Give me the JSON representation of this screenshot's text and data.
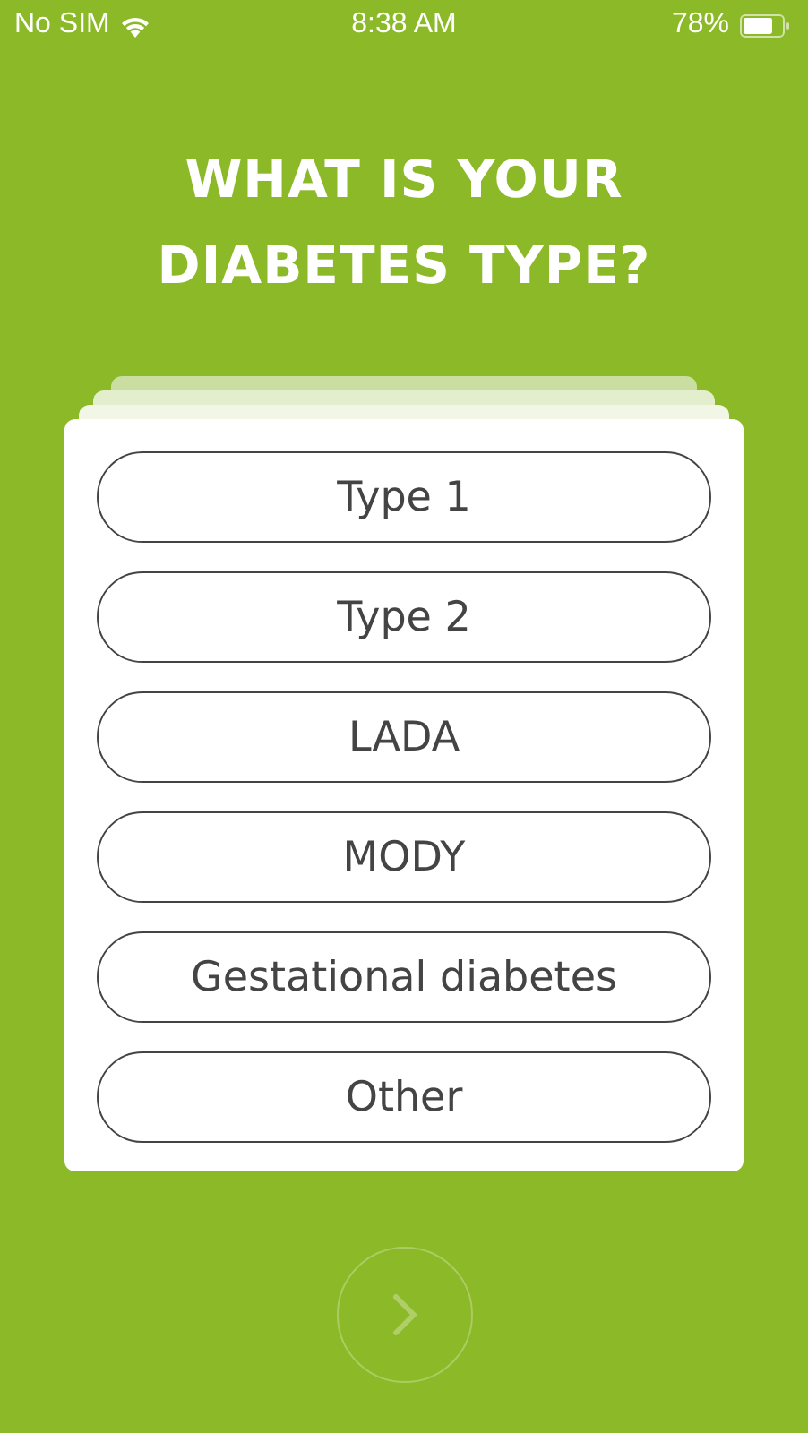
{
  "status_bar": {
    "carrier": "No SIM",
    "time": "8:38 AM",
    "battery": "78%"
  },
  "title": "WHAT IS YOUR DIABETES TYPE?",
  "options": [
    {
      "label": "Type 1",
      "selected": false
    },
    {
      "label": "Type 2",
      "selected": false
    },
    {
      "label": "LADA",
      "selected": false
    },
    {
      "label": "MODY",
      "selected": false
    },
    {
      "label": "Gestational diabetes",
      "selected": false
    },
    {
      "label": "Other",
      "selected": false
    }
  ],
  "next_button": {
    "disabled": true
  }
}
